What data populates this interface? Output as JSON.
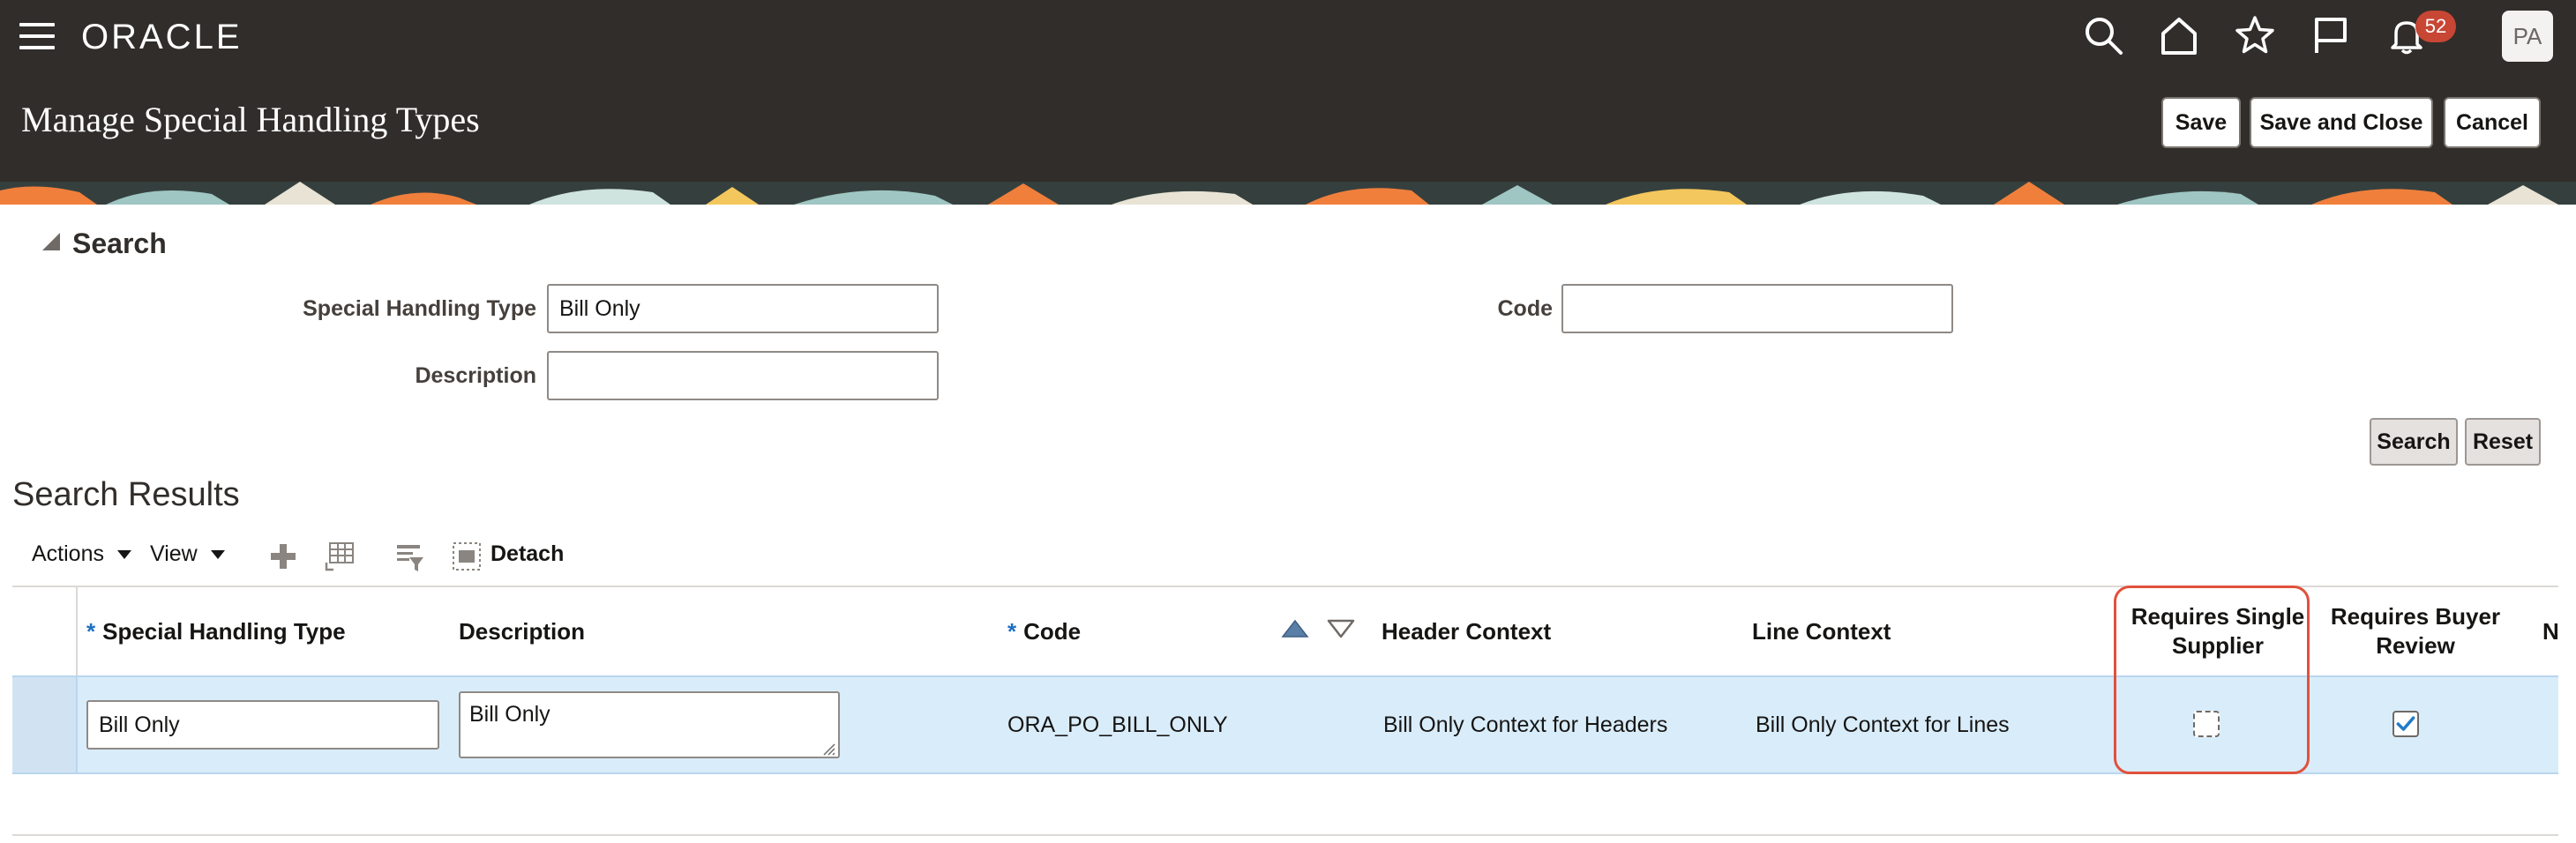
{
  "app": {
    "logo": "ORACLE",
    "notification_count": "52",
    "user_initials": "PA"
  },
  "header": {
    "title": "Manage Special Handling Types",
    "buttons": {
      "save": "Save",
      "save_close": "Save and Close",
      "cancel": "Cancel"
    }
  },
  "search": {
    "heading": "Search",
    "fields": {
      "special_handling_type": {
        "label": "Special Handling Type",
        "value": "Bill Only"
      },
      "code": {
        "label": "Code",
        "value": ""
      },
      "description": {
        "label": "Description",
        "value": ""
      }
    },
    "buttons": {
      "search": "Search",
      "reset": "Reset"
    }
  },
  "results": {
    "heading": "Search Results",
    "toolbar": {
      "actions": "Actions",
      "view": "View",
      "detach": "Detach"
    },
    "columns": {
      "special_handling_type": "Special Handling Type",
      "description": "Description",
      "code": "Code",
      "header_context": "Header Context",
      "line_context": "Line Context",
      "requires_single_supplier": "Requires Single Supplier",
      "requires_buyer_review": "Requires Buyer Review",
      "next_col_fragment": "N"
    },
    "rows": [
      {
        "special_handling_type": "Bill Only",
        "description": "Bill Only",
        "code": "ORA_PO_BILL_ONLY",
        "header_context": "Bill Only Context for Headers",
        "line_context": "Bill Only Context for Lines",
        "requires_single_supplier": false,
        "requires_buyer_review": true
      }
    ]
  },
  "colors": {
    "topbar": "#312d2a",
    "badge": "#c74634",
    "selected_row": "#d9ecfa",
    "highlight_border": "#e0513c",
    "checkbox_check": "#227ac8",
    "required_star": "#1e6fc3"
  },
  "icons": [
    "hamburger-icon",
    "search-icon",
    "home-icon",
    "star-icon",
    "flag-icon",
    "bell-icon",
    "add-icon",
    "freeze-icon",
    "query-by-example-icon",
    "detach-icon",
    "sort-ascending-icon",
    "sort-descending-icon"
  ]
}
